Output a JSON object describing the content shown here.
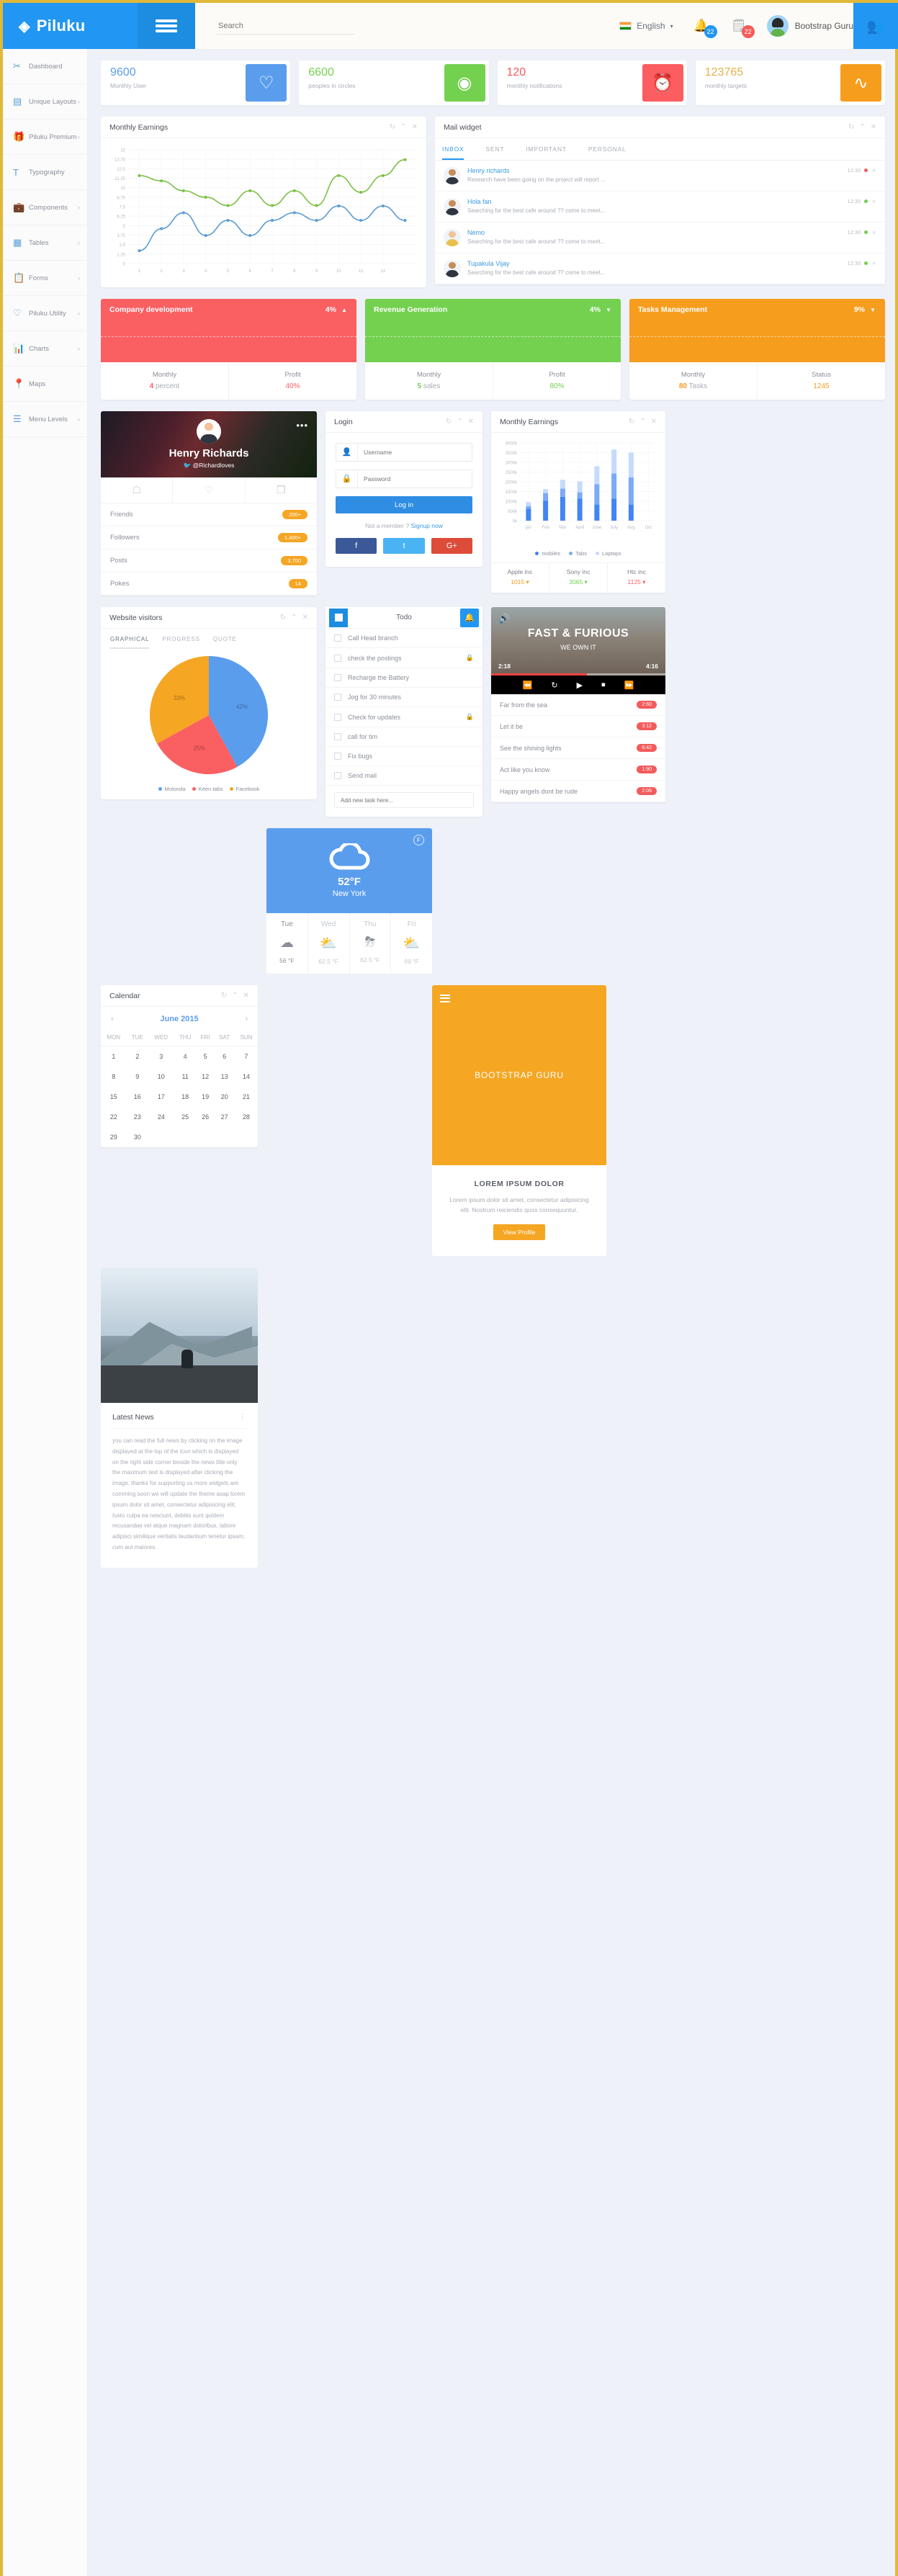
{
  "header": {
    "brand": "Piluku",
    "brand_icon": "gem-icon",
    "search_placeholder": "Search",
    "language": "English",
    "notifications_count": "22",
    "messages_count": "22",
    "user_name": "Bootstrap Guru"
  },
  "sidebar": {
    "items": [
      {
        "label": "Dashboard",
        "icon": "scissors-icon",
        "chevron": false
      },
      {
        "label": "Unique Layouts",
        "icon": "layout-icon",
        "chevron": true
      },
      {
        "label": "Piluku Premium",
        "icon": "gift-icon",
        "chevron": true
      },
      {
        "label": "Typography",
        "icon": "typography-icon",
        "chevron": false
      },
      {
        "label": "Components",
        "icon": "briefcase-icon",
        "chevron": true
      },
      {
        "label": "Tables",
        "icon": "table-icon",
        "chevron": true
      },
      {
        "label": "Forms",
        "icon": "form-icon",
        "chevron": true
      },
      {
        "label": "Piluku Utility",
        "icon": "heart-icon",
        "chevron": true
      },
      {
        "label": "Charts",
        "icon": "chart-icon",
        "chevron": true
      },
      {
        "label": "Maps",
        "icon": "map-pin-icon",
        "chevron": false
      },
      {
        "label": "Menu Levels",
        "icon": "menu-icon",
        "chevron": true
      }
    ]
  },
  "stats": [
    {
      "value": "9600",
      "label": "Monthly User",
      "icon": "heart-icon",
      "color": "#5a9ded",
      "cls": "blue"
    },
    {
      "value": "6600",
      "label": "peoples in circles",
      "icon": "circles-icon",
      "color": "#74d04f",
      "cls": "green"
    },
    {
      "value": "120",
      "label": "monthly notifications",
      "icon": "alarm-icon",
      "color": "#fb5d61",
      "cls": "red"
    },
    {
      "value": "123765",
      "label": "monthly targets",
      "icon": "wave-icon",
      "color": "#f79d1e",
      "cls": "orange"
    }
  ],
  "line_panel": {
    "title": "Monthly Earnings"
  },
  "mail": {
    "title": "Mail widget",
    "tabs": [
      "INBOX",
      "SENT",
      "IMPORTANT",
      "PERSONAL"
    ],
    "active_tab": "INBOX",
    "items": [
      {
        "name": "Henry richards",
        "preview": "Research have been going on the project will report ...",
        "time": "12:30",
        "status": "#f45b5b"
      },
      {
        "name": "Hola fan",
        "preview": "Searching for the best cafe around ?? come to meet...",
        "time": "12:30",
        "status": "#74d04f"
      },
      {
        "name": "Nemo",
        "preview": "Searching for the best cafe around ?? come to meet...",
        "time": "12:30",
        "status": "#74d04f"
      },
      {
        "name": "Tupakula Vijay",
        "preview": "Searching for the best cafe around ?? come to meet...",
        "time": "12:30",
        "status": "#74d04f"
      }
    ]
  },
  "tri_panels": [
    {
      "title": "Company development",
      "pct": "4%",
      "arrow": "▲",
      "color": "#fa5f62",
      "k1": "Monthly",
      "v1a": "4",
      "v1b": "percent",
      "k2": "Profit",
      "v2": "40%"
    },
    {
      "title": "Revenue Generation",
      "pct": "4%",
      "arrow": "▼",
      "color": "#74d04f",
      "k1": "Monthly",
      "v1a": "5",
      "v1b": "sales",
      "k2": "Profit",
      "v2": "80%"
    },
    {
      "title": "Tasks Management",
      "pct": "9%",
      "arrow": "▼",
      "color": "#f79d1e",
      "k1": "Monthly",
      "v1a": "80",
      "v1b": "Tasks",
      "k2": "Status",
      "v2": "1245"
    }
  ],
  "profile": {
    "name": "Henry Richards",
    "handle": "@Richardloves",
    "icons": [
      "user-icon",
      "heart-icon",
      "chat-icon"
    ],
    "rows": [
      {
        "label": "Friends",
        "value": "200+"
      },
      {
        "label": "Followers",
        "value": "1,400+"
      },
      {
        "label": "Posts",
        "value": "3,700"
      },
      {
        "label": "Pokes",
        "value": "14"
      }
    ]
  },
  "login": {
    "title": "Login",
    "username_placeholder": "Username",
    "password_placeholder": "Password",
    "button": "Log in",
    "not_member": "Not a member ?",
    "signup": "Signup now",
    "socials": [
      {
        "name": "facebook-icon",
        "glyph": "f",
        "color": "#3b5998"
      },
      {
        "name": "twitter-icon",
        "glyph": "t",
        "color": "#4ab3f4"
      },
      {
        "name": "google-plus-icon",
        "glyph": "G+",
        "color": "#dd4b39"
      }
    ]
  },
  "bar_panel": {
    "title": "Monthly Earnings",
    "stats": [
      {
        "label": "Apple inc",
        "value": "1015",
        "color": "#f79d1e"
      },
      {
        "label": "Sony inc",
        "value": "3065",
        "color": "#74d04f"
      },
      {
        "label": "Htc inc",
        "value": "1125",
        "color": "#fb5d61"
      }
    ]
  },
  "pie_panel": {
    "title": "Website visitors",
    "tabs": [
      "GRAPHICAL",
      "PROGRESS",
      "QUOTE"
    ],
    "active_tab": "GRAPHICAL"
  },
  "todo": {
    "title": "Todo",
    "items": [
      {
        "text": "Call Head branch",
        "lock": false
      },
      {
        "text": "check the postings",
        "lock": true
      },
      {
        "text": "Recharge the Battery",
        "lock": false
      },
      {
        "text": "Jog for 30 minutes",
        "lock": false
      },
      {
        "text": "Check for updates",
        "lock": true
      },
      {
        "text": "call for tim",
        "lock": false
      },
      {
        "text": "Fix bugs",
        "lock": false
      },
      {
        "text": "Send mail",
        "lock": false
      }
    ],
    "add_placeholder": "Add new task here..."
  },
  "music": {
    "title": "FAST & FURIOUS",
    "subtitle": "WE OWN IT",
    "time_current": "2:18",
    "time_total": "4:16",
    "controls": [
      "rewind-icon",
      "repeat-icon",
      "play-icon",
      "stop-icon",
      "forward-icon"
    ],
    "tracks": [
      {
        "name": "Far from the sea",
        "time": "2:60"
      },
      {
        "name": "Let it be",
        "time": "3:12"
      },
      {
        "name": "See the shining lights",
        "time": "6:42"
      },
      {
        "name": "Act like you know",
        "time": "1:90"
      },
      {
        "name": "Happy angels dont be rude",
        "time": "2:06"
      }
    ]
  },
  "weather": {
    "unit_badge": "F",
    "temp": "52°F",
    "city": "New York",
    "forecast": [
      {
        "day": "Tue",
        "icon": "snow-cloud-icon",
        "temp": "56 °F",
        "active": true
      },
      {
        "day": "Wed",
        "icon": "sun-cloud-icon",
        "temp": "62.5 °F",
        "active": false
      },
      {
        "day": "Thu",
        "icon": "storm-cloud-icon",
        "temp": "62.5 °F",
        "active": false
      },
      {
        "day": "Fri",
        "icon": "sun-cloud-icon",
        "temp": "69 °F",
        "active": false
      }
    ]
  },
  "calendar": {
    "title": "Calendar",
    "month": "June 2015",
    "weekdays": [
      "MON",
      "TUE",
      "WED",
      "THU",
      "FRI",
      "SAT",
      "SUN"
    ],
    "weeks": [
      [
        "1",
        "2",
        "3",
        "4",
        "5",
        "6",
        "7"
      ],
      [
        "8",
        "9",
        "10",
        "11",
        "12",
        "13",
        "14"
      ],
      [
        "15",
        "16",
        "17",
        "18",
        "19",
        "20",
        "21"
      ],
      [
        "22",
        "23",
        "24",
        "25",
        "26",
        "27",
        "28"
      ],
      [
        "29",
        "30",
        "",
        "",
        "",
        "",
        ""
      ]
    ]
  },
  "guru": {
    "banner": "BOOTSTRAP GURU",
    "heading": "LOREM IPSUM DOLOR",
    "body": "Lorem ipsum dolor sit amet, consectetur adipisicing elit. Nostrum reiciendis quos consequuntur.",
    "button": "View Profile"
  },
  "news": {
    "title": "Latest News",
    "body": "you can read the full news by clicking on the image displayed at the top of the icon which is displayed on the right side corner beside the news title only the maximum text is displayed after clicking the image. thanks for supporting us more widgets are comming soon we will update the theme asap lorem ipsum dolor sit amet, consectetur adipisicing elit. Iusto culpa ea nesciunt, debitis sunt quidem recusandae vel atque magnam doloribus, labore adipisci similique veritatis laudantium tenetur ipsam, cum aut maiores."
  },
  "chart_data": [
    {
      "type": "line",
      "title": "Monthly Earnings",
      "x": [
        1,
        2,
        3,
        4,
        5,
        6,
        7,
        8,
        9,
        10,
        11,
        12
      ],
      "xlabel": "",
      "ylabel": "",
      "ylim": [
        0,
        15
      ],
      "yticks": [
        0,
        1.25,
        2.5,
        3.75,
        5,
        6.25,
        7.5,
        8.75,
        10,
        11.25,
        12.5,
        13.75,
        15
      ],
      "grid": true,
      "legend": "none",
      "series": [
        {
          "name": "green",
          "color": "#7bc043",
          "values": [
            11.6,
            10.9,
            9.6,
            8.75,
            7.65,
            9.6,
            7.65,
            9.6,
            7.65,
            11.6,
            9.4,
            11.6,
            13.7
          ]
        },
        {
          "name": "blue",
          "color": "#5b9bd5",
          "values": [
            1.7,
            4.6,
            6.7,
            3.7,
            5.7,
            3.7,
            5.7,
            6.7,
            5.7,
            7.6,
            5.7,
            7.6,
            5.7
          ]
        }
      ]
    },
    {
      "type": "bar",
      "title": "Monthly Earnings",
      "categories": [
        "jan",
        "Feb",
        "Mar",
        "April",
        "June",
        "July",
        "Aug",
        "Oct"
      ],
      "xlabel": "",
      "ylabel": "",
      "ylim": [
        0,
        4000
      ],
      "yticks": [
        0,
        500,
        1000,
        1500,
        2000,
        2500,
        3000,
        3500,
        4000
      ],
      "ytick_labels": [
        "0k",
        "500k",
        "1000k",
        "1500k",
        "2000k",
        "2500k",
        "3000k",
        "3500k",
        "4000k"
      ],
      "stacked": true,
      "grid": true,
      "legend": "bottom",
      "series": [
        {
          "name": "mobiles",
          "color": "#4285f4",
          "values": [
            620,
            1020,
            1230,
            1130,
            830,
            1130,
            830,
            0
          ]
        },
        {
          "name": "Tabs",
          "color": "#7baaf7",
          "values": [
            130,
            400,
            420,
            330,
            1050,
            1300,
            1400,
            0
          ]
        },
        {
          "name": "Laptops",
          "color": "#c6dafc",
          "values": [
            200,
            200,
            450,
            560,
            920,
            1230,
            1270,
            0
          ]
        }
      ]
    },
    {
      "type": "pie",
      "title": "Website visitors",
      "labels": [
        "Motorola",
        "Keen tabs",
        "Facebook"
      ],
      "values": [
        42,
        25,
        33
      ],
      "value_labels": [
        "42%",
        "25%",
        "33%"
      ],
      "colors": [
        "#5a9ded",
        "#fa5f62",
        "#f5a623"
      ],
      "legend": "bottom"
    }
  ]
}
